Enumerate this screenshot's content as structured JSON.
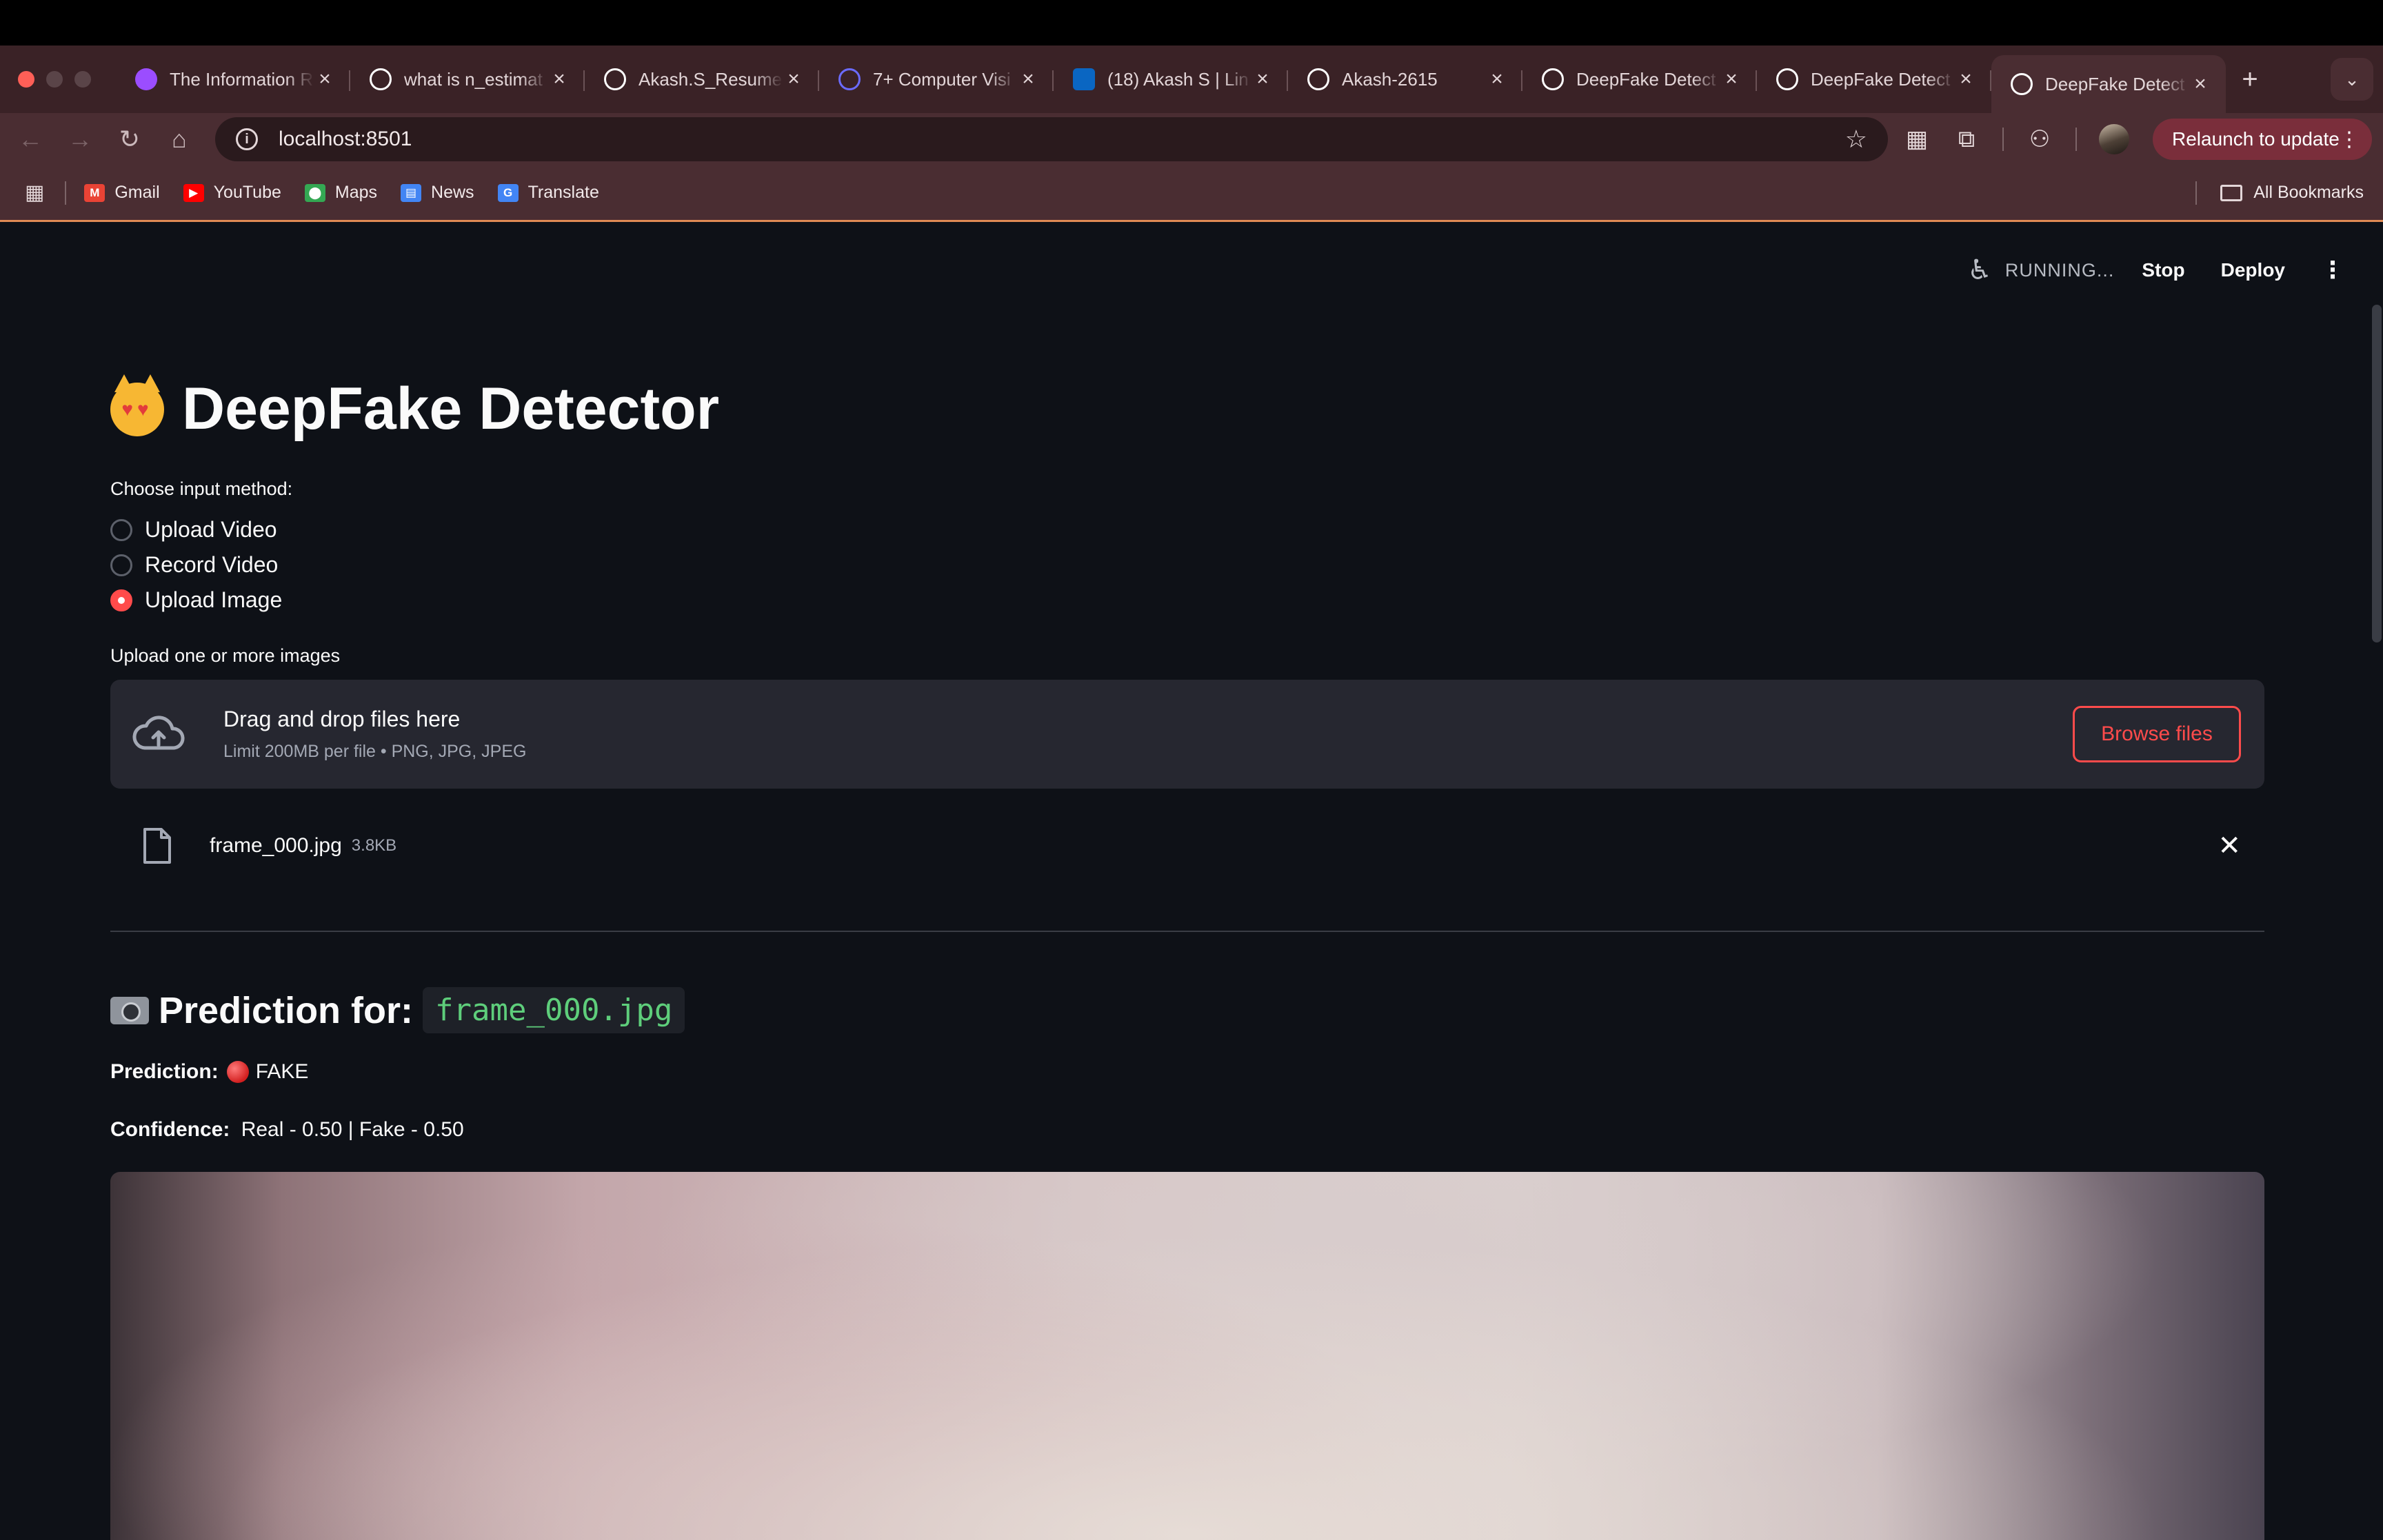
{
  "browser": {
    "tabs": [
      {
        "title": "The Information R",
        "icon": "purple-hex-icon",
        "color": "#9b4dff",
        "active": false
      },
      {
        "title": "what is n_estimat",
        "icon": "google-icon",
        "color": "#ffffff",
        "active": false
      },
      {
        "title": "Akash.S_Resume",
        "icon": "chatgpt-icon",
        "color": "#ffffff",
        "active": false
      },
      {
        "title": "7+ Computer Visi",
        "icon": "globe-icon",
        "color": "#6b6bff",
        "active": false
      },
      {
        "title": "(18) Akash S | Lin",
        "icon": "linkedin-icon",
        "color": "#0a66c2",
        "active": false
      },
      {
        "title": "Akash-2615",
        "icon": "github-icon",
        "color": "#ffffff",
        "active": false
      },
      {
        "title": "DeepFake Detect",
        "icon": "streamlit-crown-icon",
        "color": "#ffffff",
        "active": false
      },
      {
        "title": "DeepFake Detect",
        "icon": "streamlit-crown-icon",
        "color": "#ffffff",
        "active": false
      },
      {
        "title": "DeepFake Detect",
        "icon": "streamlit-crown-icon",
        "color": "#ffffff",
        "active": true
      }
    ],
    "url": "localhost:8501",
    "relaunch_label": "Relaunch to update",
    "bookmarks": [
      {
        "label": "Gmail",
        "icon": "gmail-icon",
        "color": "#ea4335",
        "glyph": "M"
      },
      {
        "label": "YouTube",
        "icon": "youtube-icon",
        "color": "#ff0000",
        "glyph": "▶"
      },
      {
        "label": "Maps",
        "icon": "maps-icon",
        "color": "#34a853",
        "glyph": "⬤"
      },
      {
        "label": "News",
        "icon": "news-icon",
        "color": "#4285f4",
        "glyph": "▤"
      },
      {
        "label": "Translate",
        "icon": "translate-icon",
        "color": "#4285f4",
        "glyph": "G"
      }
    ],
    "all_bookmarks_label": "All Bookmarks"
  },
  "st_header": {
    "status": "RUNNING...",
    "stop_label": "Stop",
    "deploy_label": "Deploy"
  },
  "app": {
    "title": "DeepFake Detector",
    "input_method_label": "Choose input method:",
    "options": [
      "Upload Video",
      "Record Video",
      "Upload Image"
    ],
    "selected_option": "Upload Image",
    "upload_label": "Upload one or more images",
    "dropzone_title": "Drag and drop files here",
    "dropzone_sub": "Limit 200MB per file • PNG, JPG, JPEG",
    "browse_label": "Browse files",
    "file_name": "frame_000.jpg",
    "file_size": "3.8KB",
    "prediction_heading": "Prediction for:",
    "prediction_file": "frame_000.jpg",
    "prediction_label": "Prediction:",
    "prediction_value": "FAKE",
    "confidence_label": "Confidence:",
    "confidence_value": "Real - 0.50 | Fake - 0.50"
  },
  "colors": {
    "accent": "#ff4b4b",
    "background": "#0e1117",
    "code_text": "#5ece7b"
  }
}
